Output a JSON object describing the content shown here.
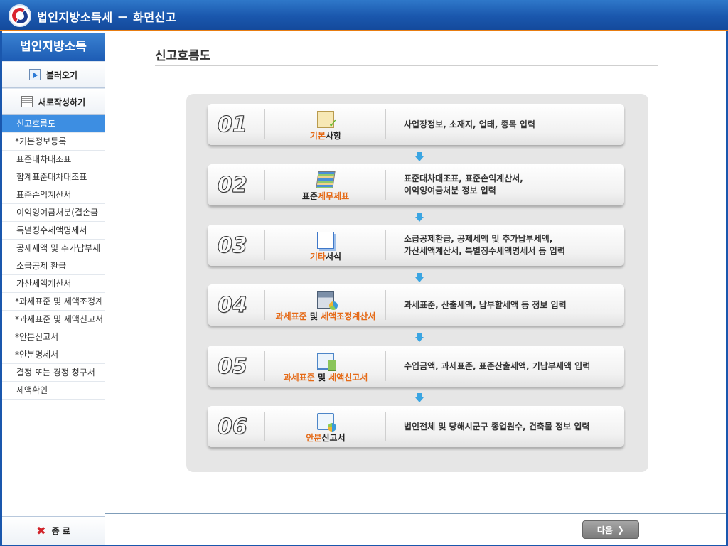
{
  "window": {
    "title": "법인지방소득세 － 화면신고"
  },
  "sidebar": {
    "header": "법인지방소득",
    "load_button": "불러오기",
    "new_button": "새로작성하기",
    "items": [
      {
        "label": "신고흐름도",
        "active": true
      },
      {
        "label": "*기본정보등록"
      },
      {
        "label": "표준대차대조표"
      },
      {
        "label": "합계표준대차대조표"
      },
      {
        "label": "표준손익계산서"
      },
      {
        "label": "이익잉여금처분(결손금"
      },
      {
        "label": "특별징수세액명세서"
      },
      {
        "label": "공제세액 및 추가납부세"
      },
      {
        "label": "소급공제 환급"
      },
      {
        "label": "가산세액계산서"
      },
      {
        "label": "*과세표준 및 세액조정계"
      },
      {
        "label": "*과세표준 및 세액신고서"
      },
      {
        "label": "*안분신고서"
      },
      {
        "label": "*안분명세서"
      },
      {
        "label": "결정 또는 경정 청구서"
      },
      {
        "label": "세액확인"
      }
    ],
    "exit_button": "종 료"
  },
  "main": {
    "page_title": "신고흐름도",
    "steps": [
      {
        "num": "01",
        "label_orange": "기본",
        "label_rest": "사항",
        "desc1": "사업장정보, 소재지, 업태, 종목 입력",
        "desc2": "",
        "icon": "clipboard-check-icon"
      },
      {
        "num": "02",
        "label_pre": "표준",
        "label_orange": "제무제표",
        "desc1": "표준대차대조표, 표준손익계산서,",
        "desc2": "이익잉여금처분 정보 입력",
        "icon": "documents-stack-icon"
      },
      {
        "num": "03",
        "label_orange": "기타",
        "label_rest": "서식",
        "desc1": "소급공제환급, 공제세액 및 추가납부세액,",
        "desc2": "가산세액계산서, 특별징수세액명세서 등 입력",
        "icon": "form-document-icon"
      },
      {
        "num": "04",
        "label_orange": "과세표준",
        "label_mid": " 및 ",
        "label_orange2": "세액조정계산서",
        "desc1": "과세표준, 산출세액, 납부할세액 등 정보 입력",
        "desc2": "",
        "icon": "calculator-chart-icon"
      },
      {
        "num": "05",
        "label_orange": "과세표준",
        "label_mid": " 및 ",
        "label_orange2": "세액신고서",
        "desc1": "수입금액, 과세표준, 표준산출세액, 기납부세액 입력",
        "desc2": "",
        "icon": "monitor-report-icon"
      },
      {
        "num": "06",
        "label_orange": "안분",
        "label_rest": "신고서",
        "desc1": "법인전체 및 당해시군구 종업원수, 건축물 정보 입력",
        "desc2": "",
        "icon": "monitor-pie-icon"
      }
    ]
  },
  "footer": {
    "next_button": "다음"
  }
}
